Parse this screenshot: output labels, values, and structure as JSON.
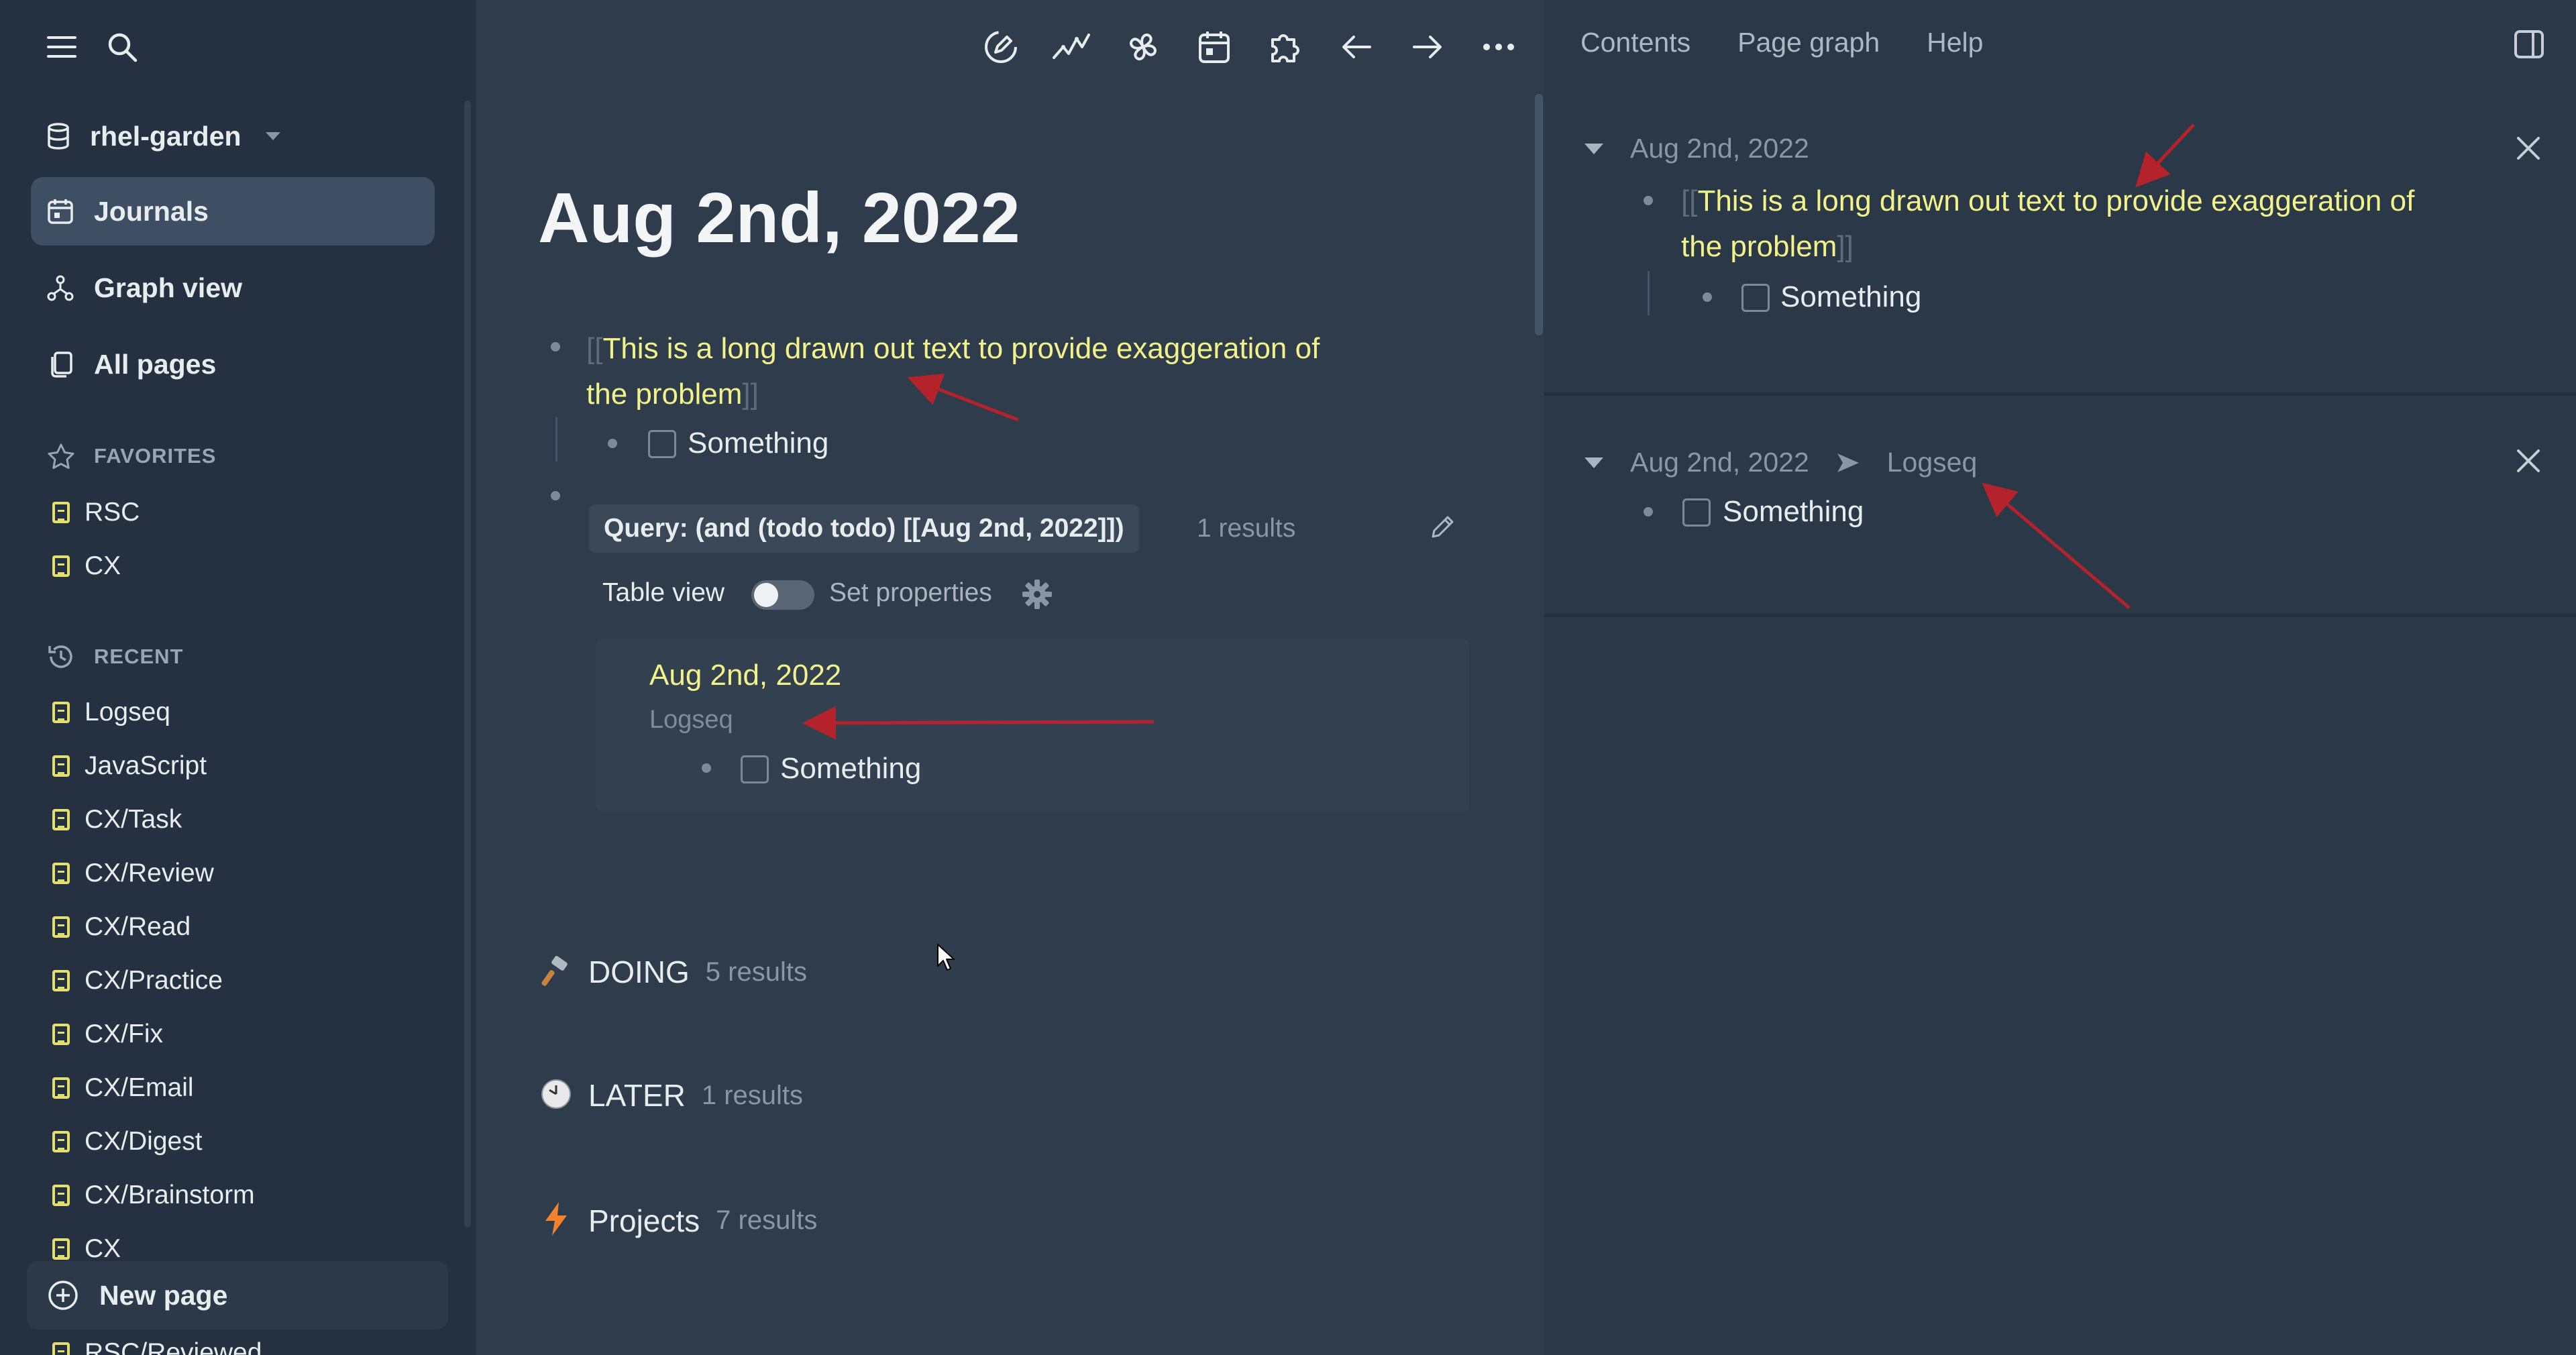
{
  "sidebar": {
    "graph_name": "rhel-garden",
    "nav": [
      {
        "label": "Journals",
        "icon": "calendar-icon"
      },
      {
        "label": "Graph view",
        "icon": "graph-icon"
      },
      {
        "label": "All pages",
        "icon": "pages-icon"
      }
    ],
    "favorites_heading": "FAVORITES",
    "favorites": [
      "RSC",
      "CX"
    ],
    "recent_heading": "RECENT",
    "recent": [
      "Logseq",
      "JavaScript",
      "CX/Task",
      "CX/Review",
      "CX/Read",
      "CX/Practice",
      "CX/Fix",
      "CX/Email",
      "CX/Digest",
      "CX/Brainstorm",
      "CX",
      "RSC/Reviewed"
    ],
    "new_page": "New page"
  },
  "toolbar": {
    "icons": [
      "pencil-icon",
      "activity-icon",
      "pinwheel-icon",
      "calendar-icon",
      "puzzle-icon",
      "arrow-left-icon",
      "arrow-right-icon",
      "more-icon"
    ]
  },
  "main": {
    "title": "Aug 2nd, 2022",
    "ref_open": "[[",
    "ref_line1": "This is a long drawn out text to provide exaggeration of",
    "ref_line2": "the problem",
    "ref_close": "]]",
    "child_task": "Something",
    "query": {
      "label": "Query: (and (todo todo) [[Aug 2nd, 2022]])",
      "count": "1 results",
      "table_view": "Table view",
      "set_properties": "Set properties",
      "result_page": "Aug 2nd, 2022",
      "result_breadcrumb": "Logseq",
      "result_task": "Something"
    },
    "groups": [
      {
        "icon": "hammer-icon",
        "title": "DOING",
        "count": "5 results"
      },
      {
        "icon": "clock-icon",
        "title": "LATER",
        "count": "1 results"
      },
      {
        "icon": "lightning-icon",
        "title": "Projects",
        "count": "7 results"
      }
    ]
  },
  "right": {
    "tabs": [
      "Contents",
      "Page graph",
      "Help"
    ],
    "block1": {
      "page": "Aug 2nd, 2022",
      "ref_open": "[[",
      "ref_line1": "This is a long drawn out text to provide exaggeration of",
      "ref_line2": "the problem",
      "ref_close": "]]",
      "task": "Something"
    },
    "block2": {
      "page": "Aug 2nd, 2022",
      "crumb": "Logseq",
      "task": "Something"
    }
  },
  "colors": {
    "background": "#2f3c4b",
    "sidebar": "#253140",
    "page_ref": "#f1f28a",
    "annotation_arrow": "#b4222c"
  }
}
